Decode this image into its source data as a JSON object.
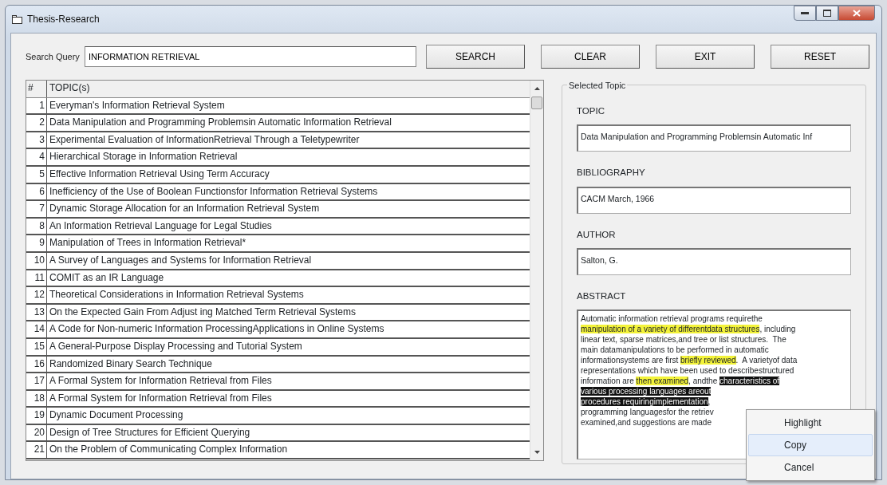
{
  "window": {
    "title": "Thesis-Research"
  },
  "search": {
    "label": "Search Query",
    "value": "INFORMATION RETRIEVAL"
  },
  "buttons": [
    "SEARCH",
    "CLEAR",
    "EXIT",
    "RESET"
  ],
  "table": {
    "columns": [
      "#",
      "TOPIC(s)"
    ],
    "rows": [
      [
        "1",
        "Everyman's Information Retrieval System"
      ],
      [
        "2",
        "Data Manipulation and Programming Problemsin Automatic Information Retrieval"
      ],
      [
        "3",
        "Experimental Evaluation of InformationRetrieval Through a Teletypewriter"
      ],
      [
        "4",
        "Hierarchical Storage in Information Retrieval"
      ],
      [
        "5",
        "Effective Information Retrieval Using Term Accuracy"
      ],
      [
        "6",
        "Inefficiency of the Use of Boolean Functionsfor Information Retrieval Systems"
      ],
      [
        "7",
        "Dynamic Storage Allocation for an Information Retrieval System"
      ],
      [
        "8",
        "An Information Retrieval Language for Legal Studies"
      ],
      [
        "9",
        "Manipulation of Trees in Information Retrieval*"
      ],
      [
        "10",
        "A Survey of Languages and Systems for Information Retrieval"
      ],
      [
        "11",
        "COMIT as an IR Language"
      ],
      [
        "12",
        "Theoretical Considerations in Information Retrieval Systems"
      ],
      [
        "13",
        "On the Expected Gain From Adjust ing Matched Term Retrieval Systems"
      ],
      [
        "14",
        "A Code for Non-numeric Information ProcessingApplications in Online Systems"
      ],
      [
        "15",
        "A General-Purpose Display Processing and Tutorial System"
      ],
      [
        "16",
        "Randomized Binary Search Technique"
      ],
      [
        "17",
        "A Formal System for Information Retrieval from Files"
      ],
      [
        "18",
        "A Formal System for Information Retrieval from Files"
      ],
      [
        "19",
        "Dynamic Document Processing"
      ],
      [
        "20",
        "Design of Tree Structures for Efficient Querying"
      ],
      [
        "21",
        "On the Problem of Communicating Complex Information"
      ]
    ]
  },
  "selected_topic": {
    "title": "Selected Topic",
    "fields": [
      {
        "label": "TOPIC",
        "value": "Data Manipulation and Programming Problemsin Automatic Inf"
      },
      {
        "label": "BIBLIOGRAPHY",
        "value": "CACM March, 1966"
      },
      {
        "label": "AUTHOR",
        "value": "Salton, G."
      }
    ],
    "abstract_label": "ABSTRACT",
    "abstract_lines": [
      [
        {
          "kind": "plain",
          "text": "Automatic information retrieval programs requirethe"
        }
      ],
      [
        {
          "kind": "highlight",
          "text": "manipulation of a variety of differentdata structures"
        },
        {
          "kind": "plain",
          "text": ", including"
        }
      ],
      [
        {
          "kind": "plain",
          "text": "linear text, sparse matrices,and tree or list structures.  The"
        }
      ],
      [
        {
          "kind": "plain",
          "text": "main datamanipulations to be performed in automatic"
        }
      ],
      [
        {
          "kind": "plain",
          "text": "informationsystems are first "
        },
        {
          "kind": "highlight",
          "text": "briefly reviewed"
        },
        {
          "kind": "plain",
          "text": ".  A varietyof data"
        }
      ],
      [
        {
          "kind": "plain",
          "text": "representations which have been used to describestructured"
        }
      ],
      [
        {
          "kind": "plain",
          "text": "information are "
        },
        {
          "kind": "highlight",
          "text": "then examined"
        },
        {
          "kind": "plain",
          "text": ", andthe "
        },
        {
          "kind": "selected",
          "text": "characteristics of"
        }
      ],
      [
        {
          "kind": "selected",
          "text": "various processing languages areout"
        }
      ],
      [
        {
          "kind": "selected",
          "text": "procedures requiringimplementation"
        },
        {
          "kind": "plain",
          "text": ", "
        }
      ],
      [
        {
          "kind": "plain",
          "text": "programming languagesfor the retriev"
        }
      ],
      [
        {
          "kind": "plain",
          "text": "examined,and suggestions are made"
        }
      ]
    ]
  },
  "context_menu": [
    {
      "label": "Highlight",
      "selected": false
    },
    {
      "label": "Copy",
      "selected": true
    },
    {
      "label": "Cancel",
      "selected": false
    }
  ]
}
